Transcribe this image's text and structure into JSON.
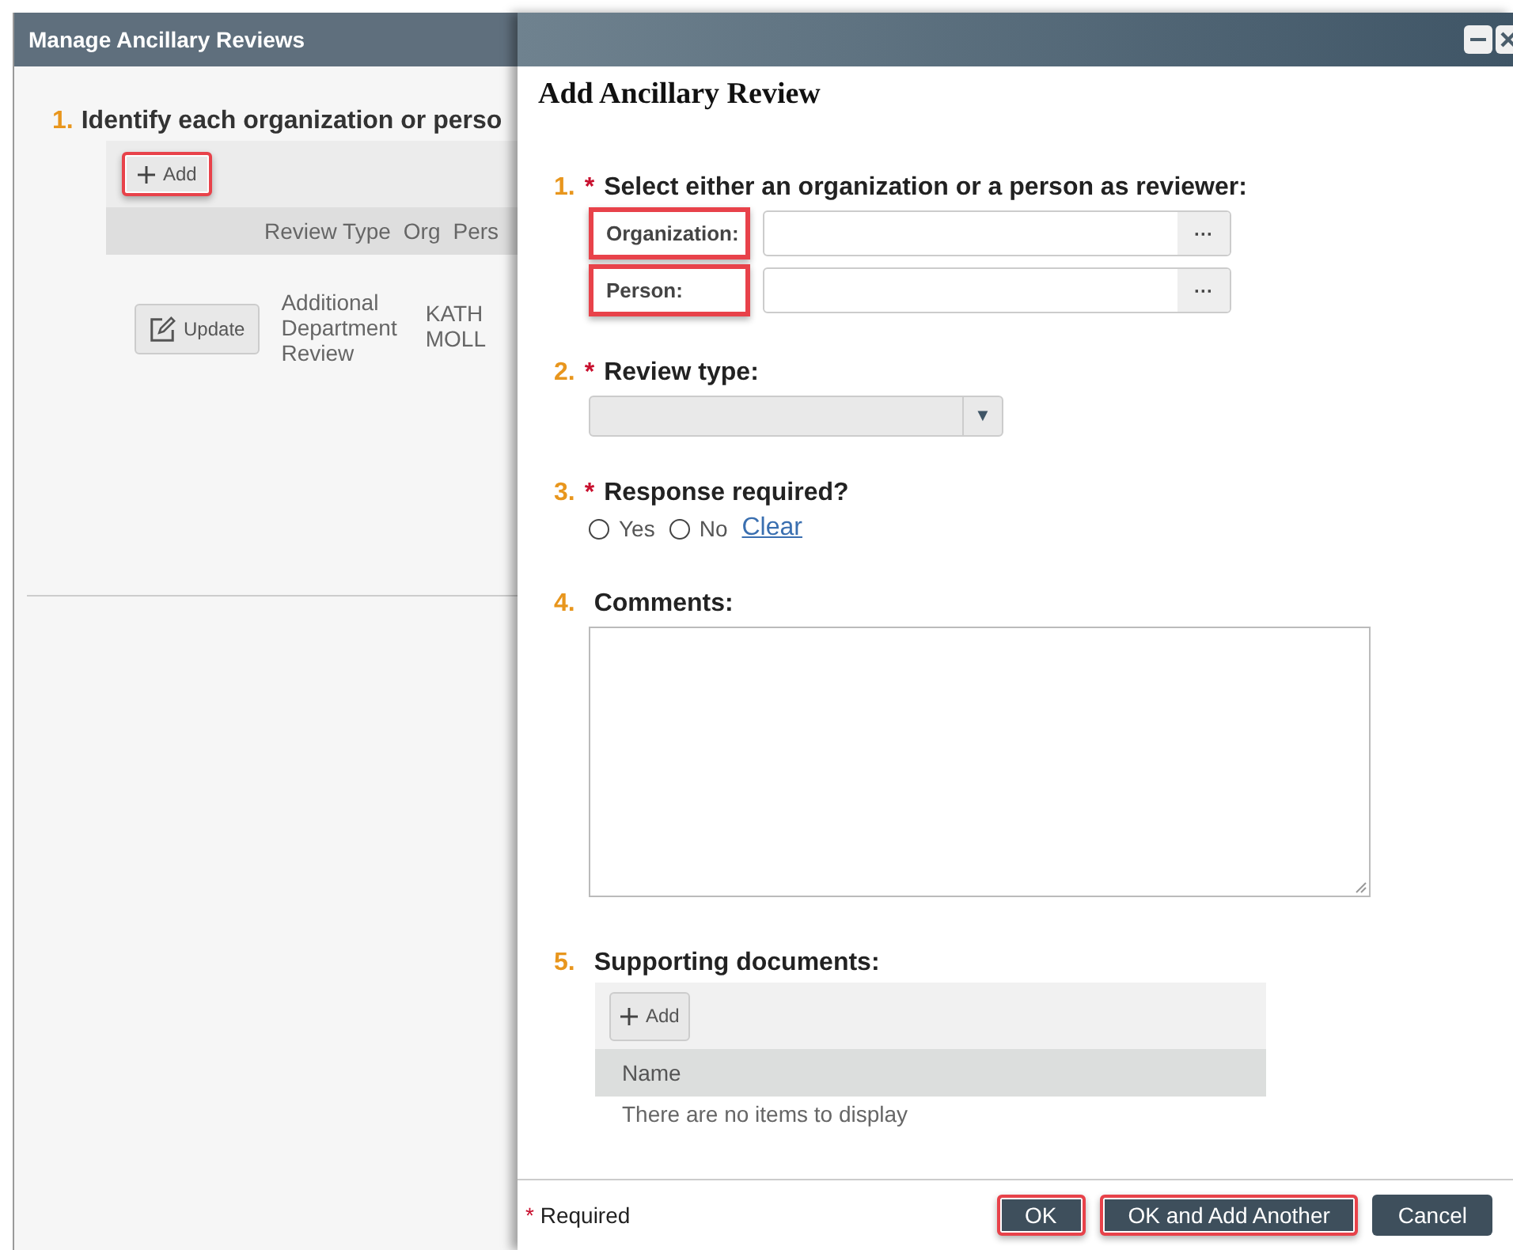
{
  "back_window": {
    "title": "Manage Ancillary Reviews",
    "step_number": "1.",
    "step_text": "Identify each organization or perso",
    "add_button": {
      "label": "Add",
      "highlighted": true
    },
    "columns": [
      "Review Type",
      "Org",
      "Pers"
    ],
    "rows": [
      {
        "button": "Update",
        "review_type": [
          "Additional",
          "Department",
          "Review"
        ],
        "column_2": [
          "KATH",
          "MOLL"
        ]
      }
    ]
  },
  "dialog": {
    "title": "Add Ancillary Review",
    "sections": [
      {
        "kind": "reviewer",
        "number": "1.",
        "required": true,
        "label": "Select either an organization or a person as reviewer:",
        "fields": [
          {
            "label": "Organization:",
            "highlighted": true,
            "button": "···"
          },
          {
            "label": "Person:",
            "highlighted": true,
            "button": "···"
          }
        ]
      },
      {
        "kind": "select",
        "number": "2.",
        "required": true,
        "label": "Review type:",
        "arrow": "▼"
      },
      {
        "kind": "radio",
        "number": "3.",
        "required": true,
        "label": "Response required?",
        "options": [
          {
            "label": "Yes",
            "selected": false
          },
          {
            "label": "No",
            "selected": false
          }
        ],
        "link": "Clear"
      },
      {
        "kind": "textarea",
        "number": "4.",
        "required": false,
        "label": "Comments:"
      },
      {
        "kind": "documents",
        "number": "5.",
        "required": false,
        "label": "Supporting documents:",
        "add_button": "Add",
        "column": "Name",
        "empty_text": "There are no items to display"
      }
    ],
    "footer": {
      "required_mark": "*",
      "required_text": "Required",
      "buttons": [
        {
          "label": "OK",
          "highlighted": true
        },
        {
          "label": "OK and Add Another",
          "highlighted": true
        },
        {
          "label": "Cancel",
          "highlighted": false
        }
      ]
    }
  }
}
